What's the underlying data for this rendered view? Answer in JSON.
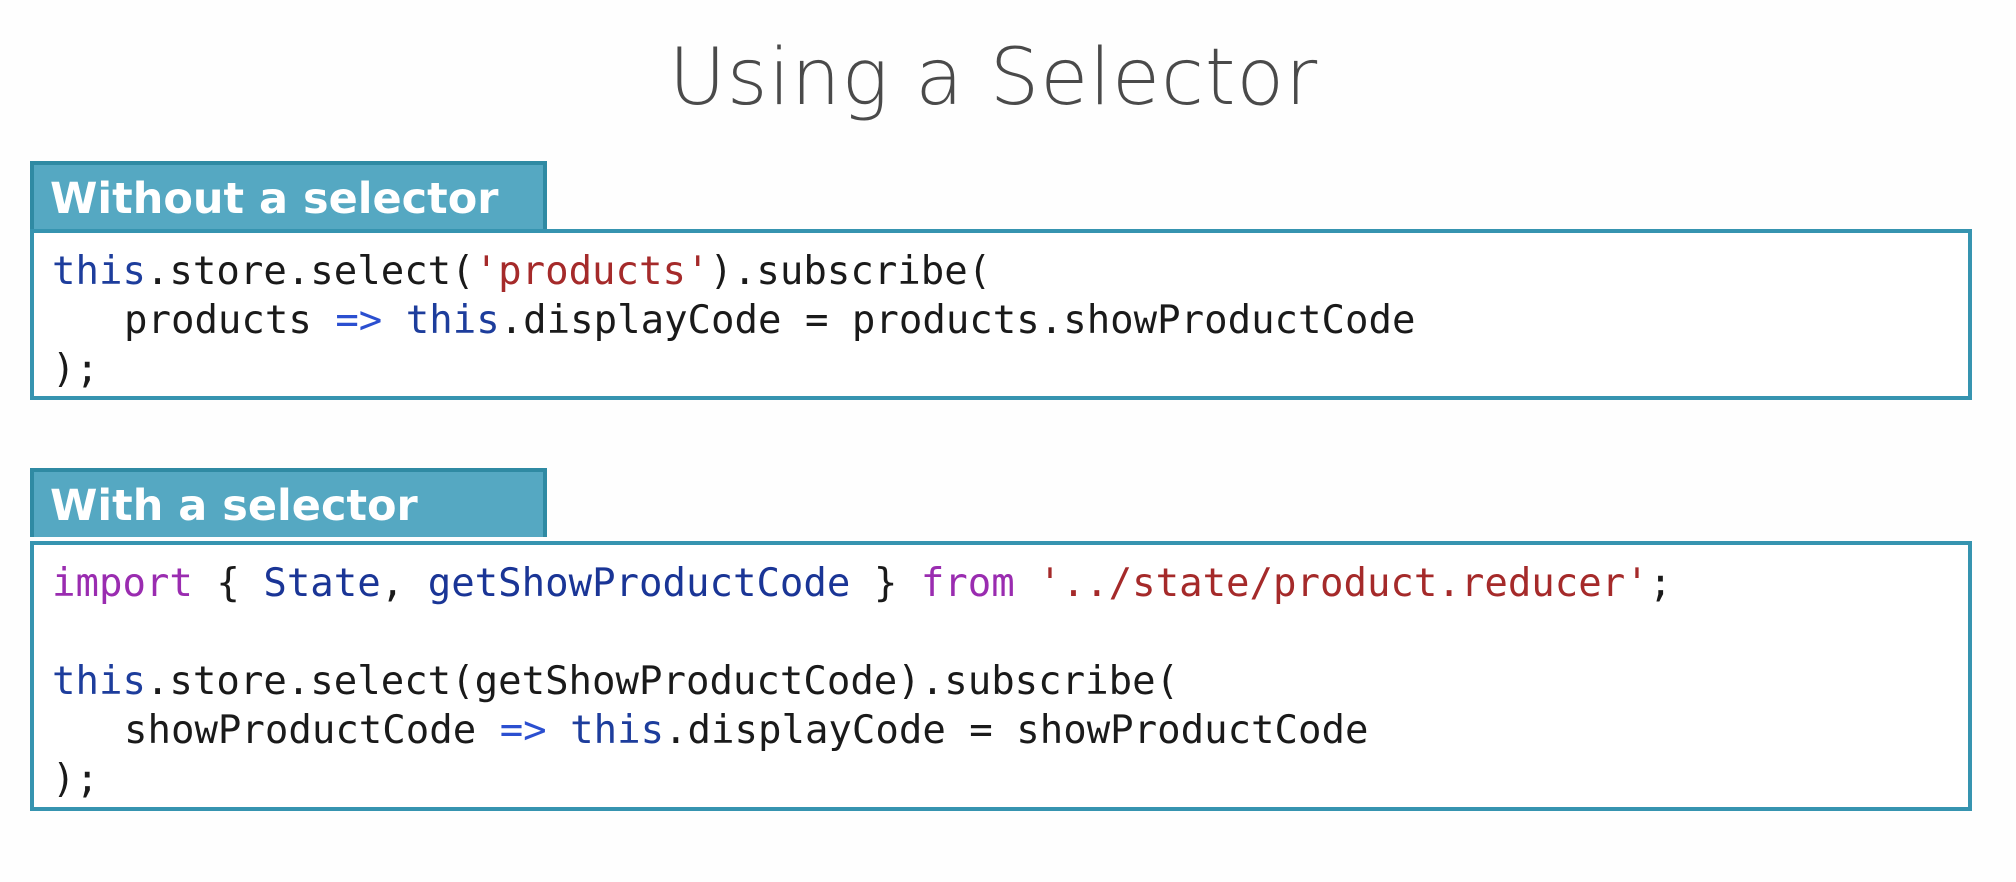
{
  "slide": {
    "title": "Using a Selector"
  },
  "without": {
    "tab_label": "Without a selector",
    "line1": {
      "kw_this": "this",
      "call": ".store.select(",
      "str": "'products'",
      "rest": ").subscribe("
    },
    "line2": {
      "param": "products ",
      "arrow": "=>",
      "kw_this": "this",
      "rest": ".displayCode = products.showProductCode"
    },
    "line3": ");"
  },
  "with": {
    "tab_label": "With a selector",
    "import_line": {
      "kw_import": "import",
      "brace_open": " { ",
      "state": "State",
      "comma": ", ",
      "selector": "getShowProductCode",
      "brace_close": " } ",
      "kw_from": "from",
      "space": " ",
      "path": "'../state/product.reducer'",
      "semi": ";"
    },
    "line1": {
      "kw_this": "this",
      "rest": ".store.select(getShowProductCode).subscribe("
    },
    "line2": {
      "param": "showProductCode ",
      "arrow": "=>",
      "kw_this": "this",
      "rest": ".displayCode = showProductCode"
    },
    "line3": ");"
  },
  "colors": {
    "tab_fill": "#55a8c2",
    "tab_border": "#2f8aa3",
    "box_border": "#3694b0",
    "keyword_this": "#1d3d9c",
    "keyword_import": "#9a2cb0",
    "string": "#a52a2a",
    "title_text": "#4a4a4a"
  }
}
